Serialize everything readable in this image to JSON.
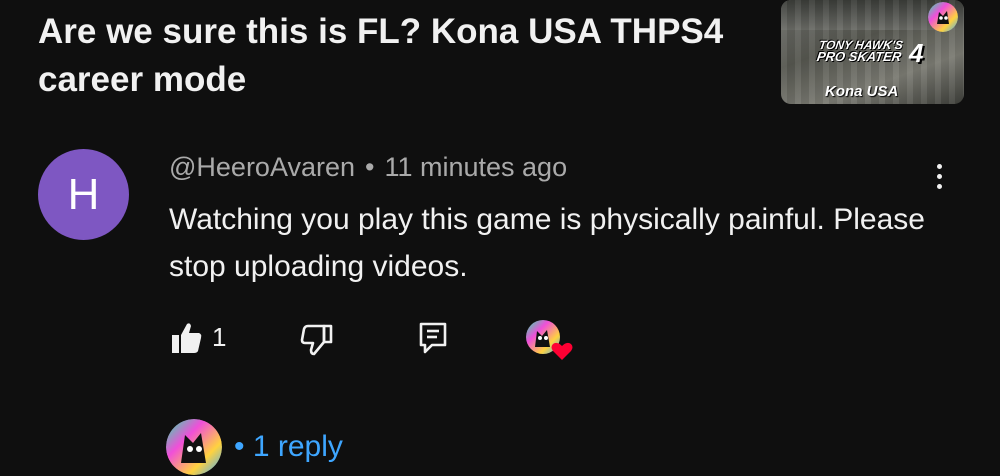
{
  "video": {
    "title": "Are we sure this is FL? Kona USA THPS4 career mode",
    "thumbnail": {
      "logo_line1": "TONY HAWK'S",
      "logo_line2": "PRO SKATER",
      "logo_number": "4",
      "caption": "Kona USA"
    }
  },
  "comment": {
    "avatar_letter": "H",
    "avatar_color": "#7e57c2",
    "author": "@HeeroAvaren",
    "separator": "•",
    "time": "11 minutes ago",
    "text": "Watching you play this game is physically painful. Please stop uploading videos.",
    "like_count": "1",
    "replies_label": "1 reply",
    "replies_prefix": "•"
  },
  "icons": {
    "like": "thumbs-up-icon",
    "dislike": "thumbs-down-icon",
    "reply": "reply-comment-icon",
    "more": "more-vertical-icon",
    "creator_heart": "red-heart-icon"
  },
  "colors": {
    "background": "#0f0f0f",
    "link": "#3ea6ff",
    "heart": "#ff0033"
  }
}
